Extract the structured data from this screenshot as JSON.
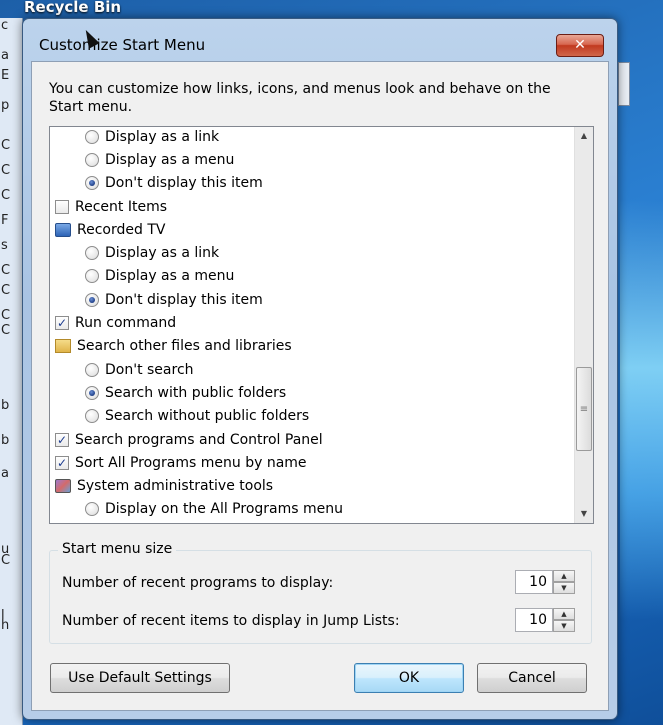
{
  "desktop": {
    "title": "Recycle Bin",
    "left_fragments": [
      "c",
      "a",
      "E",
      "p",
      "C",
      "C",
      "C",
      "F",
      "s",
      "C",
      "C",
      "C",
      "C",
      "b",
      "b",
      "a",
      "u",
      "C",
      "l",
      "h"
    ]
  },
  "dialog": {
    "title": "Customize Start Menu",
    "close_label": "✕",
    "description": "You can customize how links, icons, and menus look and behave on the Start menu.",
    "list_items": [
      {
        "level": 1,
        "type": "radio",
        "checked": false,
        "label": "Display as a link"
      },
      {
        "level": 1,
        "type": "radio",
        "checked": false,
        "label": "Display as a menu"
      },
      {
        "level": 1,
        "type": "radio",
        "checked": true,
        "label": "Don't display this item"
      },
      {
        "level": 0,
        "type": "checkbox",
        "checked": false,
        "label": "Recent Items"
      },
      {
        "level": 0,
        "type": "icon",
        "icon": "recorded-tv-icon",
        "label": "Recorded TV"
      },
      {
        "level": 1,
        "type": "radio",
        "checked": false,
        "label": "Display as a link"
      },
      {
        "level": 1,
        "type": "radio",
        "checked": false,
        "label": "Display as a menu"
      },
      {
        "level": 1,
        "type": "radio",
        "checked": true,
        "label": "Don't display this item"
      },
      {
        "level": 0,
        "type": "checkbox",
        "checked": true,
        "label": "Run command"
      },
      {
        "level": 0,
        "type": "icon",
        "icon": "search-folder-icon",
        "label": "Search other files and libraries"
      },
      {
        "level": 1,
        "type": "radio",
        "checked": false,
        "label": "Don't search"
      },
      {
        "level": 1,
        "type": "radio",
        "checked": true,
        "label": "Search with public folders"
      },
      {
        "level": 1,
        "type": "radio",
        "checked": false,
        "label": "Search without public folders"
      },
      {
        "level": 0,
        "type": "checkbox",
        "checked": true,
        "label": "Search programs and Control Panel"
      },
      {
        "level": 0,
        "type": "checkbox",
        "checked": true,
        "label": "Sort All Programs menu by name"
      },
      {
        "level": 0,
        "type": "icon",
        "icon": "admin-tools-icon",
        "label": "System administrative tools"
      },
      {
        "level": 1,
        "type": "radio",
        "checked": false,
        "label": "Display on the All Programs menu"
      }
    ],
    "group_title": "Start menu size",
    "recent_programs_label": "Number of recent programs to display:",
    "recent_programs_value": "10",
    "jump_list_label": "Number of recent items to display in Jump Lists:",
    "jump_list_value": "10",
    "default_button": "Use Default Settings",
    "ok_button": "OK",
    "cancel_button": "Cancel"
  }
}
